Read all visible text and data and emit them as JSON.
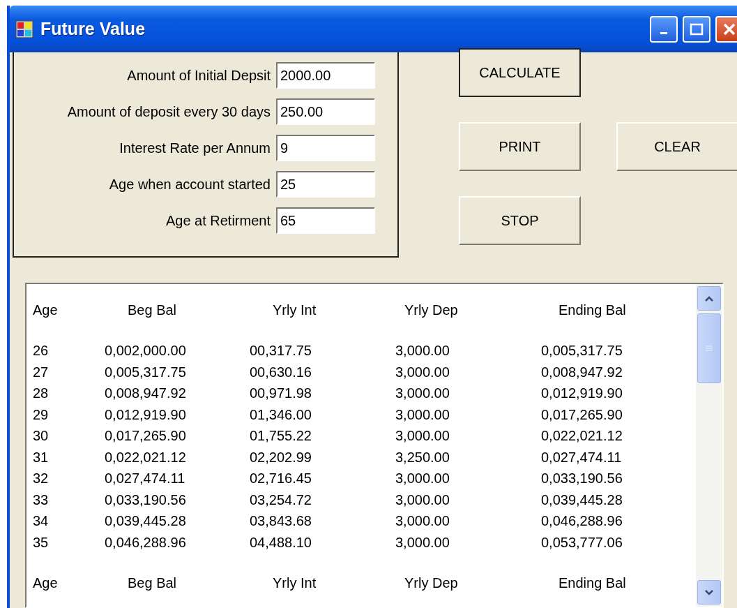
{
  "window": {
    "title": "Future Value"
  },
  "inputs": [
    {
      "label": "Amount of Initial Depsit",
      "value": "2000.00"
    },
    {
      "label": "Amount of deposit every 30 days",
      "value": "250.00"
    },
    {
      "label": "Interest Rate per Annum",
      "value": "9"
    },
    {
      "label": "Age when account started",
      "value": "25"
    },
    {
      "label": "Age at Retirment",
      "value": "65"
    }
  ],
  "buttons": [
    {
      "label": "CALCULATE",
      "default": true
    },
    {
      "label": "PRINT",
      "default": false
    },
    {
      "label": "CLEAR",
      "default": false
    },
    {
      "label": "STOP",
      "default": false
    }
  ],
  "list": {
    "lines": [
      {
        "kind": "header",
        "cells": [
          "Age",
          "Beg Bal",
          "Yrly Int",
          "Yrly Dep",
          "Ending Bal"
        ]
      },
      {
        "kind": "spacer"
      },
      {
        "kind": "row",
        "cells": [
          "26",
          "0,002,000.00",
          "00,317.75",
          "3,000.00",
          "0,005,317.75"
        ]
      },
      {
        "kind": "row",
        "cells": [
          "27",
          "0,005,317.75",
          "00,630.16",
          "3,000.00",
          "0,008,947.92"
        ]
      },
      {
        "kind": "row",
        "cells": [
          "28",
          "0,008,947.92",
          "00,971.98",
          "3,000.00",
          "0,012,919.90"
        ]
      },
      {
        "kind": "row",
        "cells": [
          "29",
          "0,012,919.90",
          "01,346.00",
          "3,000.00",
          "0,017,265.90"
        ]
      },
      {
        "kind": "row",
        "cells": [
          "30",
          "0,017,265.90",
          "01,755.22",
          "3,000.00",
          "0,022,021.12"
        ]
      },
      {
        "kind": "row",
        "cells": [
          "31",
          "0,022,021.12",
          "02,202.99",
          "3,250.00",
          "0,027,474.11"
        ]
      },
      {
        "kind": "row",
        "cells": [
          "32",
          "0,027,474.11",
          "02,716.45",
          "3,000.00",
          "0,033,190.56"
        ]
      },
      {
        "kind": "row",
        "cells": [
          "33",
          "0,033,190.56",
          "03,254.72",
          "3,000.00",
          "0,039,445.28"
        ]
      },
      {
        "kind": "row",
        "cells": [
          "34",
          "0,039,445.28",
          "03,843.68",
          "3,000.00",
          "0,046,288.96"
        ]
      },
      {
        "kind": "row",
        "cells": [
          "35",
          "0,046,288.96",
          "04,488.10",
          "3,000.00",
          "0,053,777.06"
        ]
      },
      {
        "kind": "spacer"
      },
      {
        "kind": "header",
        "cells": [
          "Age",
          "Beg Bal",
          "Yrly Int",
          "Yrly Dep",
          "Ending Bal"
        ]
      }
    ]
  }
}
